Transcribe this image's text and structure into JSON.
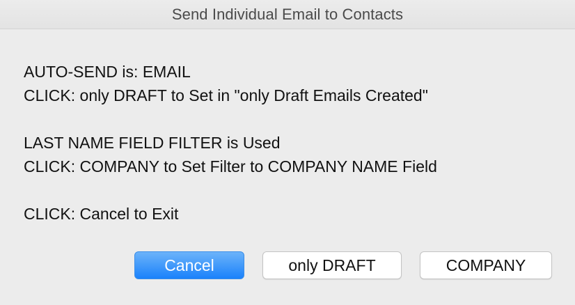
{
  "window": {
    "title": "Send Individual Email to Contacts"
  },
  "message": {
    "lines": [
      "AUTO-SEND is: EMAIL",
      "CLICK: only DRAFT to Set in \"only Draft Emails Created\"",
      "LAST NAME FIELD FILTER is Used",
      "CLICK: COMPANY to Set Filter to COMPANY NAME Field",
      "CLICK: Cancel to Exit"
    ]
  },
  "buttons": {
    "cancel_label": "Cancel",
    "draft_label": "only DRAFT",
    "company_label": "COMPANY"
  },
  "colors": {
    "accent": "#1a82fb",
    "background": "#ececec"
  }
}
